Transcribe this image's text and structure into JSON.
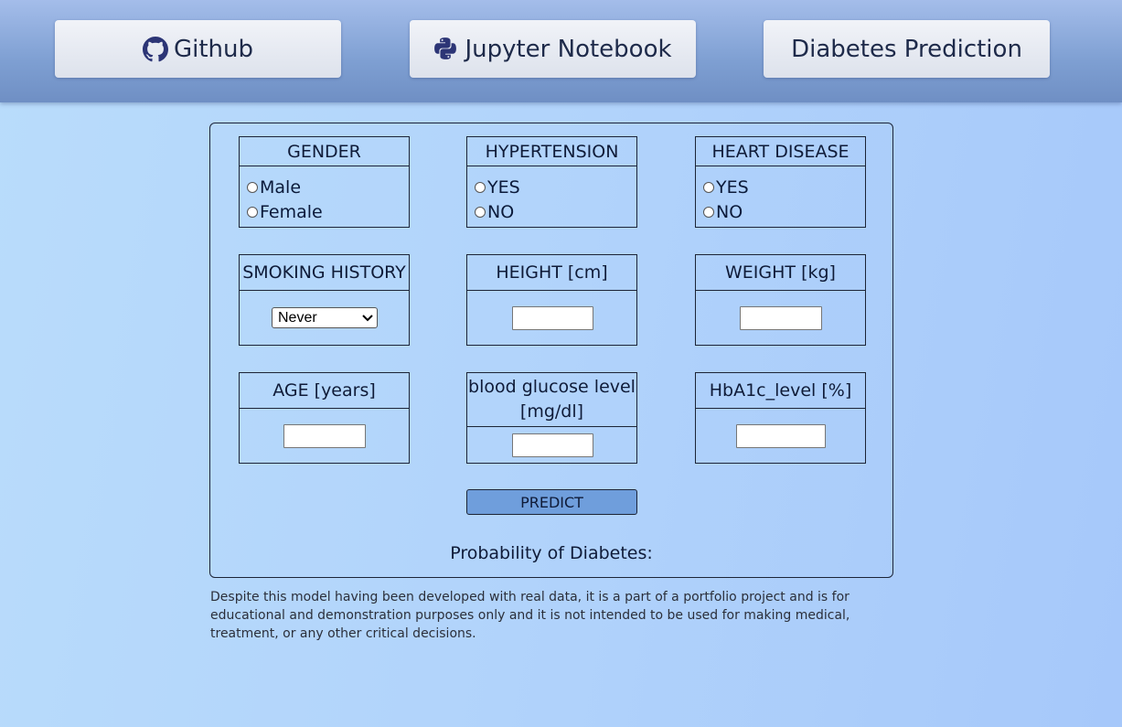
{
  "nav": {
    "github_label": "Github",
    "jupyter_label": "Jupyter Notebook",
    "diabetes_label": "Diabetes Prediction"
  },
  "form": {
    "gender": {
      "title": "GENDER",
      "options": [
        "Male",
        "Female"
      ]
    },
    "hypertension": {
      "title": "HYPERTENSION",
      "options": [
        "YES",
        "NO"
      ]
    },
    "heart_disease": {
      "title": "HEART DISEASE",
      "options": [
        "YES",
        "NO"
      ]
    },
    "smoking": {
      "title": "SMOKING HISTORY",
      "selected": "Never"
    },
    "height": {
      "title": "HEIGHT [cm]",
      "value": ""
    },
    "weight": {
      "title": "WEIGHT [kg]",
      "value": ""
    },
    "age": {
      "title": "AGE [years]",
      "value": ""
    },
    "glucose": {
      "title_line1": "blood glucose level",
      "title_line2": "[mg/dl]",
      "value": ""
    },
    "hba1c": {
      "title": "HbA1c_level [%]",
      "value": ""
    },
    "predict_label": "PREDICT",
    "probability_label": "Probability of Diabetes:"
  },
  "disclaimer": "Despite this model having been developed with real data, it is a part of a portfolio project and is for educational and demonstration purposes only and it is not intended to be used for making medical, treatment, or any other critical decisions.",
  "icons": {
    "github": "github-icon",
    "jupyter": "python-icon",
    "select_arrow": "chevron-down-icon"
  },
  "colors": {
    "accent": "#6f9edc",
    "topbar": "#7e9fd2"
  }
}
